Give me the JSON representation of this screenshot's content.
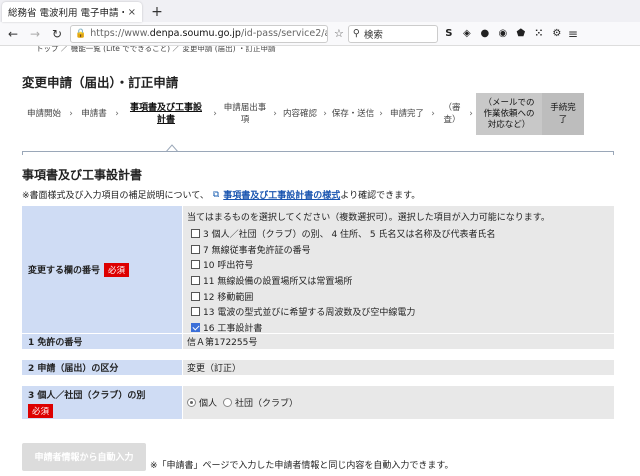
{
  "browser": {
    "tab_title": "総務省 電波利用 電子申請・",
    "tab_close": "×",
    "new_tab": "+",
    "url_gray_prefix": "https://www.",
    "url_host": "denpa.soumu.go.jp",
    "url_path": "/id-pass/service2/a",
    "search_placeholder": "検索",
    "ext_1": "S"
  },
  "breadcrumb": "トップ ／ 機能一覧 (Lite でできること) ／ 変更申請 (届出) ・訂正申請",
  "page_title": "変更申請（届出）・訂正申請",
  "steps": [
    {
      "label": "申請開始"
    },
    {
      "label": "申請書"
    },
    {
      "label": "事項書及び工事設\n計書"
    },
    {
      "label": "申請届出事\n項"
    },
    {
      "label": "内容確認"
    },
    {
      "label": "保存・送信"
    },
    {
      "label": "申請完了"
    },
    {
      "label": "（審\n査）"
    },
    {
      "label": "（メールでの\n作業依頼への\n対応など）"
    },
    {
      "label": "手続完\n了"
    }
  ],
  "step_sep": "›",
  "section_title": "事項書及び工事設計書",
  "note": {
    "prefix": "※書面様式及び入力項目の補足説明について、",
    "link": "事項書及び工事設計書の様式",
    "suffix": "より確認できます。"
  },
  "form": {
    "change_fields_label": "変更する欄の番号",
    "required": "必須",
    "change_fields_help": "当てはまるものを選択してください（複数選択可）。選択した項目が入力可能になります。",
    "options": [
      {
        "label": "3 個人／社団（クラブ）の別、 4 住所、 5 氏名又は名称及び代表者氏名",
        "checked": false
      },
      {
        "label": "7 無線従事者免許証の番号",
        "checked": false
      },
      {
        "label": "10 呼出符号",
        "checked": false
      },
      {
        "label": "11 無線設備の設置場所又は常置場所",
        "checked": false
      },
      {
        "label": "12 移動範囲",
        "checked": false
      },
      {
        "label": "13 電波の型式並びに希望する周波数及び空中線電力",
        "checked": false
      },
      {
        "label": "16 工事設計書",
        "checked": true
      }
    ],
    "license_label": "1 免許の番号",
    "license_value": "信Ａ第172255号",
    "category_label": "2 申請（届出）の区分",
    "category_value": "変更（訂正）",
    "individual_label": "3 個人／社団（クラブ）の別",
    "radio_individual": "個人",
    "radio_club": "社団（クラブ）"
  },
  "autofill": {
    "button": "申請者情報から自動入力",
    "note": "※「申請書」ページで入力した申請者情報と同じ内容を自動入力できます。"
  }
}
